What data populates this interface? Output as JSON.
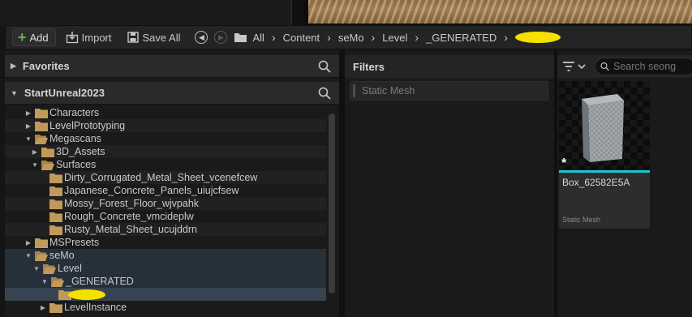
{
  "toolbar": {
    "add_label": "Add",
    "import_label": "Import",
    "save_all_label": "Save All"
  },
  "breadcrumb": {
    "items": [
      "All",
      "Content",
      "seMo",
      "Level",
      "_GENERATED"
    ]
  },
  "sidebar": {
    "favorites_label": "Favorites",
    "project_label": "StartUnreal2023",
    "tree": [
      {
        "label": "Characters"
      },
      {
        "label": "LevelPrototyping"
      },
      {
        "label": "Megascans"
      },
      {
        "label": "3D_Assets"
      },
      {
        "label": "Surfaces"
      },
      {
        "label": "Dirty_Corrugated_Metal_Sheet_vcenefcew"
      },
      {
        "label": "Japanese_Concrete_Panels_uiujcfsew"
      },
      {
        "label": "Mossy_Forest_Floor_wjvpahk"
      },
      {
        "label": "Rough_Concrete_vmcideplw"
      },
      {
        "label": "Rusty_Metal_Sheet_ucujddrn"
      },
      {
        "label": "MSPresets"
      },
      {
        "label": "seMo"
      },
      {
        "label": "Level"
      },
      {
        "label": "_GENERATED"
      },
      {
        "label": ""
      },
      {
        "label": "LevelInstance"
      }
    ]
  },
  "filters": {
    "title": "Filters",
    "items": [
      {
        "label": "Static Mesh"
      }
    ]
  },
  "assets": {
    "search_placeholder": "Search seong",
    "items": [
      {
        "name": "Box_62582E5A",
        "type": "Static Mesh",
        "color": "#1fc5d6"
      }
    ]
  },
  "colors": {
    "accent_add": "#5fb64b",
    "folder": "#c19a5b",
    "selection": "#374350",
    "static_mesh_bar": "#1fc5d6"
  },
  "icons": [
    "plus-icon",
    "import-icon",
    "save-icon",
    "back-icon",
    "forward-icon",
    "folder-icon",
    "search-icon",
    "filter-icon",
    "chevron-down-icon",
    "caret-right-icon",
    "caret-down-icon"
  ]
}
